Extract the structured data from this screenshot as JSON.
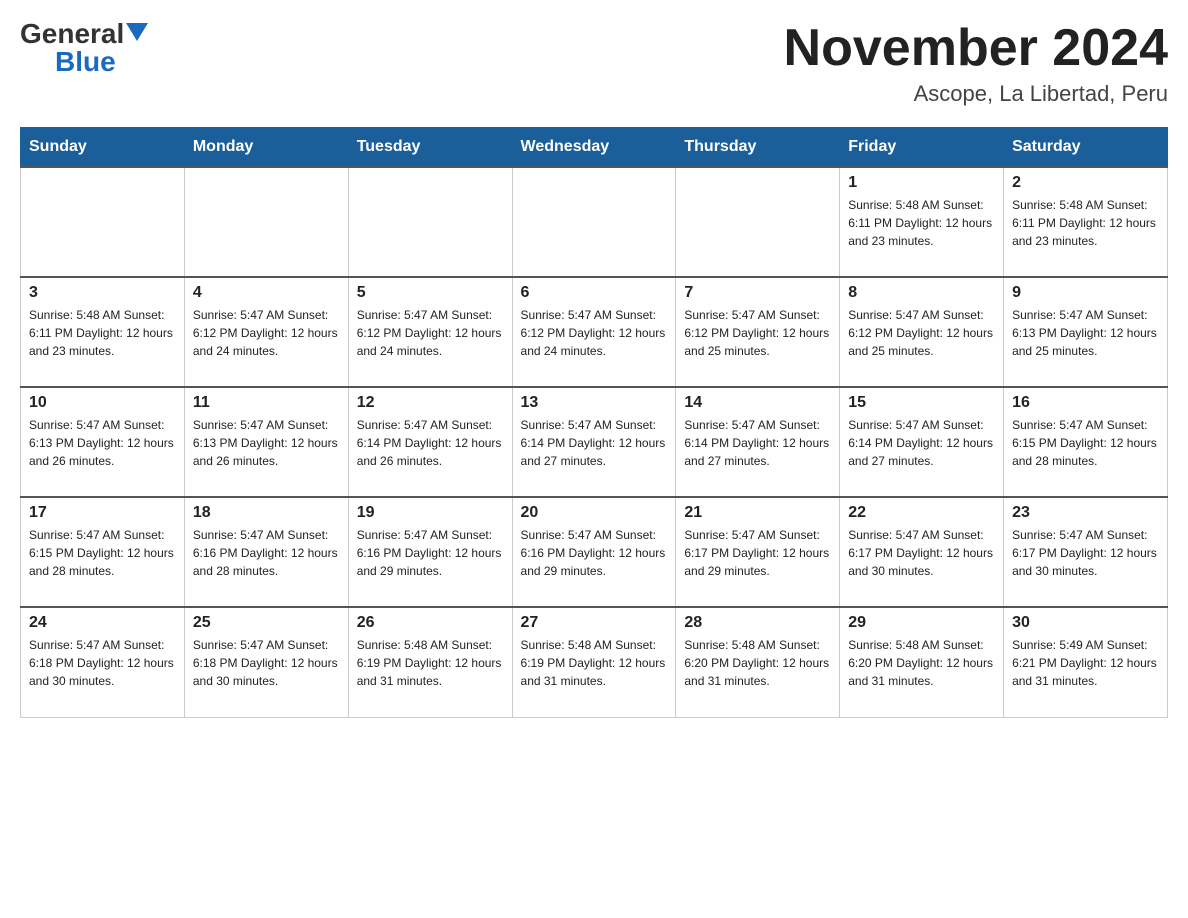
{
  "header": {
    "logo_general": "General",
    "logo_blue": "Blue",
    "title": "November 2024",
    "subtitle": "Ascope, La Libertad, Peru"
  },
  "days_of_week": [
    "Sunday",
    "Monday",
    "Tuesday",
    "Wednesday",
    "Thursday",
    "Friday",
    "Saturday"
  ],
  "weeks": [
    {
      "days": [
        {
          "num": "",
          "info": ""
        },
        {
          "num": "",
          "info": ""
        },
        {
          "num": "",
          "info": ""
        },
        {
          "num": "",
          "info": ""
        },
        {
          "num": "",
          "info": ""
        },
        {
          "num": "1",
          "info": "Sunrise: 5:48 AM\nSunset: 6:11 PM\nDaylight: 12 hours\nand 23 minutes."
        },
        {
          "num": "2",
          "info": "Sunrise: 5:48 AM\nSunset: 6:11 PM\nDaylight: 12 hours\nand 23 minutes."
        }
      ]
    },
    {
      "days": [
        {
          "num": "3",
          "info": "Sunrise: 5:48 AM\nSunset: 6:11 PM\nDaylight: 12 hours\nand 23 minutes."
        },
        {
          "num": "4",
          "info": "Sunrise: 5:47 AM\nSunset: 6:12 PM\nDaylight: 12 hours\nand 24 minutes."
        },
        {
          "num": "5",
          "info": "Sunrise: 5:47 AM\nSunset: 6:12 PM\nDaylight: 12 hours\nand 24 minutes."
        },
        {
          "num": "6",
          "info": "Sunrise: 5:47 AM\nSunset: 6:12 PM\nDaylight: 12 hours\nand 24 minutes."
        },
        {
          "num": "7",
          "info": "Sunrise: 5:47 AM\nSunset: 6:12 PM\nDaylight: 12 hours\nand 25 minutes."
        },
        {
          "num": "8",
          "info": "Sunrise: 5:47 AM\nSunset: 6:12 PM\nDaylight: 12 hours\nand 25 minutes."
        },
        {
          "num": "9",
          "info": "Sunrise: 5:47 AM\nSunset: 6:13 PM\nDaylight: 12 hours\nand 25 minutes."
        }
      ]
    },
    {
      "days": [
        {
          "num": "10",
          "info": "Sunrise: 5:47 AM\nSunset: 6:13 PM\nDaylight: 12 hours\nand 26 minutes."
        },
        {
          "num": "11",
          "info": "Sunrise: 5:47 AM\nSunset: 6:13 PM\nDaylight: 12 hours\nand 26 minutes."
        },
        {
          "num": "12",
          "info": "Sunrise: 5:47 AM\nSunset: 6:14 PM\nDaylight: 12 hours\nand 26 minutes."
        },
        {
          "num": "13",
          "info": "Sunrise: 5:47 AM\nSunset: 6:14 PM\nDaylight: 12 hours\nand 27 minutes."
        },
        {
          "num": "14",
          "info": "Sunrise: 5:47 AM\nSunset: 6:14 PM\nDaylight: 12 hours\nand 27 minutes."
        },
        {
          "num": "15",
          "info": "Sunrise: 5:47 AM\nSunset: 6:14 PM\nDaylight: 12 hours\nand 27 minutes."
        },
        {
          "num": "16",
          "info": "Sunrise: 5:47 AM\nSunset: 6:15 PM\nDaylight: 12 hours\nand 28 minutes."
        }
      ]
    },
    {
      "days": [
        {
          "num": "17",
          "info": "Sunrise: 5:47 AM\nSunset: 6:15 PM\nDaylight: 12 hours\nand 28 minutes."
        },
        {
          "num": "18",
          "info": "Sunrise: 5:47 AM\nSunset: 6:16 PM\nDaylight: 12 hours\nand 28 minutes."
        },
        {
          "num": "19",
          "info": "Sunrise: 5:47 AM\nSunset: 6:16 PM\nDaylight: 12 hours\nand 29 minutes."
        },
        {
          "num": "20",
          "info": "Sunrise: 5:47 AM\nSunset: 6:16 PM\nDaylight: 12 hours\nand 29 minutes."
        },
        {
          "num": "21",
          "info": "Sunrise: 5:47 AM\nSunset: 6:17 PM\nDaylight: 12 hours\nand 29 minutes."
        },
        {
          "num": "22",
          "info": "Sunrise: 5:47 AM\nSunset: 6:17 PM\nDaylight: 12 hours\nand 30 minutes."
        },
        {
          "num": "23",
          "info": "Sunrise: 5:47 AM\nSunset: 6:17 PM\nDaylight: 12 hours\nand 30 minutes."
        }
      ]
    },
    {
      "days": [
        {
          "num": "24",
          "info": "Sunrise: 5:47 AM\nSunset: 6:18 PM\nDaylight: 12 hours\nand 30 minutes."
        },
        {
          "num": "25",
          "info": "Sunrise: 5:47 AM\nSunset: 6:18 PM\nDaylight: 12 hours\nand 30 minutes."
        },
        {
          "num": "26",
          "info": "Sunrise: 5:48 AM\nSunset: 6:19 PM\nDaylight: 12 hours\nand 31 minutes."
        },
        {
          "num": "27",
          "info": "Sunrise: 5:48 AM\nSunset: 6:19 PM\nDaylight: 12 hours\nand 31 minutes."
        },
        {
          "num": "28",
          "info": "Sunrise: 5:48 AM\nSunset: 6:20 PM\nDaylight: 12 hours\nand 31 minutes."
        },
        {
          "num": "29",
          "info": "Sunrise: 5:48 AM\nSunset: 6:20 PM\nDaylight: 12 hours\nand 31 minutes."
        },
        {
          "num": "30",
          "info": "Sunrise: 5:49 AM\nSunset: 6:21 PM\nDaylight: 12 hours\nand 31 minutes."
        }
      ]
    }
  ]
}
